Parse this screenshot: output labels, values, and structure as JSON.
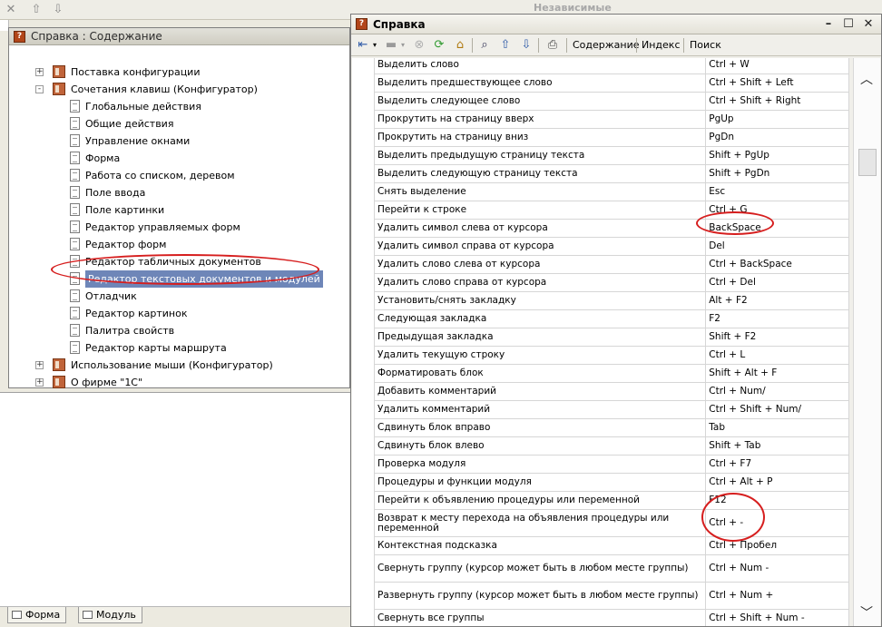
{
  "background": {
    "right_label": "Независимые",
    "bottom_tabs": [
      "Форма",
      "Модуль"
    ],
    "icons": [
      "close-icon",
      "arrow-up-icon",
      "arrow-down-icon"
    ]
  },
  "contents_window": {
    "title": "Справка : Содержание",
    "tree": [
      {
        "label": "Поставка конфигурации",
        "level": 0,
        "type": "book",
        "expander": "+"
      },
      {
        "label": "Сочетания клавиш (Конфигуратор)",
        "level": 0,
        "type": "book",
        "expander": "-"
      },
      {
        "label": "Глобальные действия",
        "level": 1,
        "type": "page"
      },
      {
        "label": "Общие действия",
        "level": 1,
        "type": "page"
      },
      {
        "label": "Управление окнами",
        "level": 1,
        "type": "page"
      },
      {
        "label": "Форма",
        "level": 1,
        "type": "page"
      },
      {
        "label": "Работа со списком, деревом",
        "level": 1,
        "type": "page"
      },
      {
        "label": "Поле ввода",
        "level": 1,
        "type": "page"
      },
      {
        "label": "Поле картинки",
        "level": 1,
        "type": "page"
      },
      {
        "label": "Редактор управляемых форм",
        "level": 1,
        "type": "page"
      },
      {
        "label": "Редактор форм",
        "level": 1,
        "type": "page"
      },
      {
        "label": "Редактор табличных документов",
        "level": 1,
        "type": "page"
      },
      {
        "label": "Редактор текстовых документов и модулей",
        "level": 1,
        "type": "page",
        "selected": true
      },
      {
        "label": "Отладчик",
        "level": 1,
        "type": "page"
      },
      {
        "label": "Редактор картинок",
        "level": 1,
        "type": "page"
      },
      {
        "label": "Палитра свойств",
        "level": 1,
        "type": "page"
      },
      {
        "label": "Редактор карты маршрута",
        "level": 1,
        "type": "page"
      },
      {
        "label": "Использование мыши (Конфигуратор)",
        "level": 0,
        "type": "book",
        "expander": "+"
      },
      {
        "label": "О фирме \"1С\"",
        "level": 0,
        "type": "book",
        "expander": "+"
      }
    ]
  },
  "help_window": {
    "title": "Справка",
    "toolbar": {
      "contents": "Содержание",
      "index": "Индекс",
      "search": "Поиск"
    },
    "rows": [
      [
        "Выделить слово",
        "Ctrl + W"
      ],
      [
        "Выделить предшествующее слово",
        "Ctrl + Shift + Left"
      ],
      [
        "Выделить следующее слово",
        "Ctrl + Shift + Right"
      ],
      [
        "Прокрутить на страницу вверх",
        "PgUp"
      ],
      [
        "Прокрутить на страницу вниз",
        "PgDn"
      ],
      [
        "Выделить предыдущую страницу текста",
        "Shift + PgUp"
      ],
      [
        "Выделить следующую страницу текста",
        "Shift + PgDn"
      ],
      [
        "Снять выделение",
        "Esc"
      ],
      [
        "Перейти к строке",
        "Ctrl + G"
      ],
      [
        "Удалить символ слева от курсора",
        "BackSpace"
      ],
      [
        "Удалить символ справа от курсора",
        "Del"
      ],
      [
        "Удалить слово слева от курсора",
        "Ctrl + BackSpace"
      ],
      [
        "Удалить слово справа от курсора",
        "Ctrl + Del"
      ],
      [
        "Установить/снять закладку",
        "Alt + F2"
      ],
      [
        "Следующая закладка",
        "F2"
      ],
      [
        "Предыдущая закладка",
        "Shift + F2"
      ],
      [
        "Удалить текущую строку",
        "Ctrl + L"
      ],
      [
        "Форматировать блок",
        "Shift + Alt + F"
      ],
      [
        "Добавить комментарий",
        "Ctrl + Num/"
      ],
      [
        "Удалить комментарий",
        "Ctrl + Shift + Num/"
      ],
      [
        "Сдвинуть блок вправо",
        "Tab"
      ],
      [
        "Сдвинуть блок влево",
        "Shift + Tab"
      ],
      [
        "Проверка модуля",
        "Ctrl + F7"
      ],
      [
        "Процедуры и функции модуля",
        "Ctrl + Alt + P"
      ],
      [
        "Перейти к объявлению процедуры или переменной",
        "F12"
      ],
      [
        "Возврат к месту перехода на объявления процедуры или переменной",
        "Ctrl + -"
      ],
      [
        "Контекстная подсказка",
        "Ctrl + Пробел"
      ],
      [
        "Свернуть группу (курсор может быть в любом месте группы)",
        "Ctrl + Num -"
      ],
      [
        "Развернуть группу (курсор может быть в любом месте группы)",
        "Ctrl + Num +"
      ],
      [
        "Свернуть все группы",
        "Ctrl + Shift + Num -"
      ],
      [
        "",
        ""
      ]
    ]
  },
  "colors": {
    "annotation": "#d61e1e",
    "selection": "#6e86b8"
  }
}
